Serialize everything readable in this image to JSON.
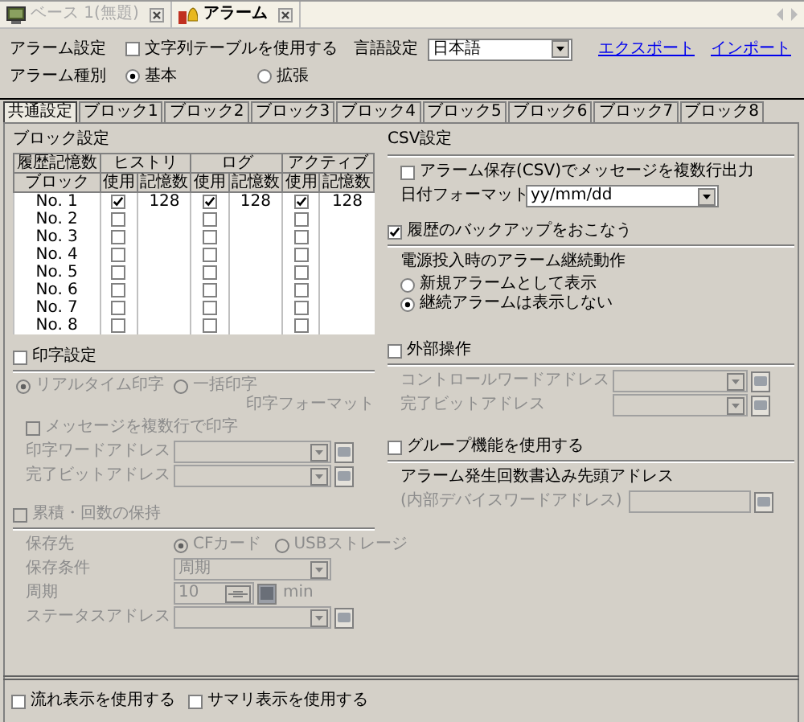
{
  "doc_tabs": [
    {
      "kind": "screen",
      "label": "ベース 1(無題)",
      "selected": false
    },
    {
      "kind": "alarm",
      "label": "アラーム",
      "selected": true
    }
  ],
  "alarm_settings": {
    "label": "アラーム設定",
    "string_table": {
      "label": "文字列テーブルを使用する",
      "checked": false
    },
    "language_label": "言語設定",
    "language": "日本語",
    "links": [
      "エクスポート",
      "インポート"
    ]
  },
  "alarm_type": {
    "label": "アラーム種別",
    "options": [
      {
        "label": "基本",
        "selected": true
      },
      {
        "label": "拡張",
        "selected": false
      }
    ]
  },
  "tabs": [
    {
      "label": "共通設定",
      "selected": true
    },
    {
      "label": "ブロック1",
      "selected": false
    },
    {
      "label": "ブロック2",
      "selected": false
    },
    {
      "label": "ブロック3",
      "selected": false
    },
    {
      "label": "ブロック4",
      "selected": false
    },
    {
      "label": "ブロック5",
      "selected": false
    },
    {
      "label": "ブロック6",
      "selected": false
    },
    {
      "label": "ブロック7",
      "selected": false
    },
    {
      "label": "ブロック8",
      "selected": false
    }
  ],
  "block_settings": {
    "title": "ブロック設定",
    "group_headers": [
      "履歴記憶数",
      "ヒストリ",
      "ログ",
      "アクティブ"
    ],
    "sub_headers": [
      "ブロック",
      "使用",
      "記憶数",
      "使用",
      "記憶数",
      "使用",
      "記憶数"
    ],
    "rows": [
      {
        "name": "No. 1",
        "cells": [
          {
            "checked": true,
            "count": "128"
          },
          {
            "checked": true,
            "count": "128"
          },
          {
            "checked": true,
            "count": "128"
          }
        ]
      },
      {
        "name": "No. 2",
        "cells": [
          {
            "checked": false
          },
          {
            "checked": false
          },
          {
            "checked": false
          }
        ]
      },
      {
        "name": "No. 3",
        "cells": [
          {
            "checked": false
          },
          {
            "checked": false
          },
          {
            "checked": false
          }
        ]
      },
      {
        "name": "No. 4",
        "cells": [
          {
            "checked": false
          },
          {
            "checked": false
          },
          {
            "checked": false
          }
        ]
      },
      {
        "name": "No. 5",
        "cells": [
          {
            "checked": false
          },
          {
            "checked": false
          },
          {
            "checked": false
          }
        ]
      },
      {
        "name": "No. 6",
        "cells": [
          {
            "checked": false
          },
          {
            "checked": false
          },
          {
            "checked": false
          }
        ]
      },
      {
        "name": "No. 7",
        "cells": [
          {
            "checked": false
          },
          {
            "checked": false
          },
          {
            "checked": false
          }
        ]
      },
      {
        "name": "No. 8",
        "cells": [
          {
            "checked": false
          },
          {
            "checked": false
          },
          {
            "checked": false
          }
        ]
      }
    ]
  },
  "print": {
    "label": "印字設定",
    "checked": false,
    "modes": [
      {
        "label": "リアルタイム印字",
        "selected": true
      },
      {
        "label": "一括印字",
        "selected": false
      }
    ],
    "format_label": "印字フォーマット",
    "multiline": {
      "label": "メッセージを複数行で印字",
      "checked": false
    },
    "fields": [
      {
        "kind": "address",
        "label": "印字ワードアドレス"
      },
      {
        "kind": "address",
        "label": "完了ビットアドレス"
      }
    ]
  },
  "retention": {
    "label": "累積・回数の保持",
    "checked": false,
    "disabled": true,
    "destination_label": "保存先",
    "destinations": [
      {
        "label": "CFカード",
        "selected": true
      },
      {
        "label": "USBストレージ",
        "selected": false
      }
    ],
    "fields": [
      {
        "kind": "select",
        "label": "保存条件",
        "value": "周期"
      },
      {
        "kind": "spin",
        "label": "周期",
        "value": "10",
        "unit": "min"
      },
      {
        "kind": "address",
        "label": "ステータスアドレス"
      }
    ]
  },
  "csv": {
    "title": "CSV設定",
    "multiline": {
      "label": "アラーム保存(CSV)でメッセージを複数行出力",
      "checked": false
    },
    "date_format_label": "日付フォーマット",
    "date_format": "yy/mm/dd"
  },
  "backup": {
    "label": "履歴のバックアップをおこなう",
    "checked": true,
    "power_on_label": "電源投入時のアラーム継続動作",
    "options": [
      {
        "label": "新規アラームとして表示",
        "selected": false
      },
      {
        "label": "継続アラームは表示しない",
        "selected": true
      }
    ]
  },
  "external": {
    "label": "外部操作",
    "checked": false,
    "fields": [
      {
        "kind": "address",
        "label": "コントロールワードアドレス"
      },
      {
        "kind": "address",
        "label": "完了ビットアドレス"
      }
    ]
  },
  "group": {
    "label": "グループ機能を使用する",
    "checked": false,
    "address_label": "アラーム発生回数書込み先頭アドレス",
    "fields": [
      {
        "kind": "text",
        "label": "(内部デバイスワードアドレス)"
      }
    ]
  },
  "display": [
    {
      "label": "流れ表示を使用する",
      "checked": false
    },
    {
      "label": "サマリ表示を使用する",
      "checked": false
    }
  ]
}
